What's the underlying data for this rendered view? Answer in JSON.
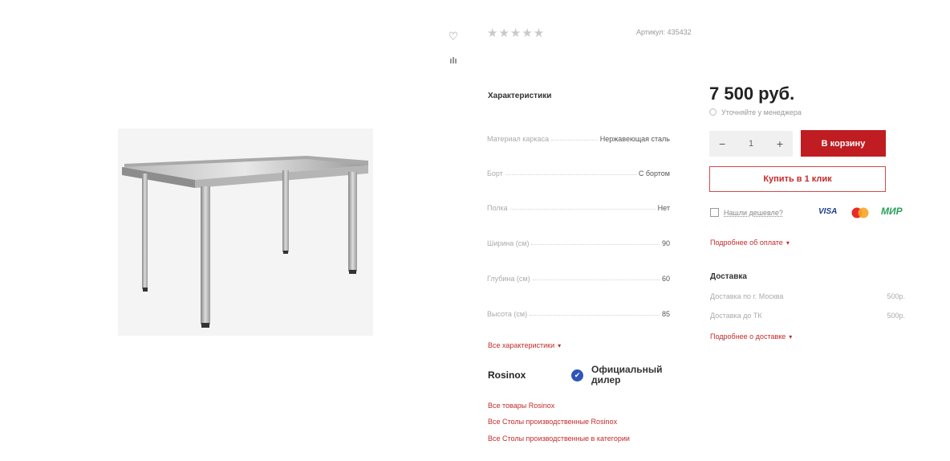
{
  "product": {
    "article_label": "Артикул: 435432",
    "price": "7 500 руб.",
    "clarify": "Уточняйте у менеджера"
  },
  "specs": {
    "title": "Характеристики",
    "rows": [
      {
        "name": "Материал каркаса",
        "value": "Нержавеющая сталь"
      },
      {
        "name": "Борт",
        "value": "С бортом"
      },
      {
        "name": "Полка",
        "value": "Нет"
      },
      {
        "name": "Ширина (см)",
        "value": "90"
      },
      {
        "name": "Глубина (см)",
        "value": "60"
      },
      {
        "name": "Высота (см)",
        "value": "85"
      }
    ],
    "all_link": "Все характеристики"
  },
  "brand": {
    "name": "Rosinox",
    "dealer_label": "Официальный дилер",
    "links": [
      "Все товары Rosinox",
      "Все Столы производственные Rosinox",
      "Все Столы производственные в категории"
    ]
  },
  "purchase": {
    "qty_minus": "−",
    "qty_value": "1",
    "qty_plus": "+",
    "cart_label": "В корзину",
    "one_click_label": "Купить в 1 клик",
    "cheaper_label": "Нашли дешевле?",
    "payment": {
      "visa": "VISA",
      "mir": "МИР"
    },
    "payment_more": "Подробнее об оплате"
  },
  "delivery": {
    "title": "Доставка",
    "rows": [
      {
        "name": "Доставка по г. Москва",
        "price": "500р."
      },
      {
        "name": "Доставка до ТК",
        "price": "500р."
      }
    ],
    "more": "Подробнее о доставке"
  },
  "icons": {
    "rating_stars": "★★★★★",
    "favorite": "♡",
    "compare": "ılı",
    "chevron": "▾",
    "check": "✔"
  },
  "rating": {
    "value": 0,
    "max": 5
  },
  "colors": {
    "accent": "#bf1d22",
    "link": "#c42a2a",
    "dealer_badge": "#2d55b8"
  }
}
